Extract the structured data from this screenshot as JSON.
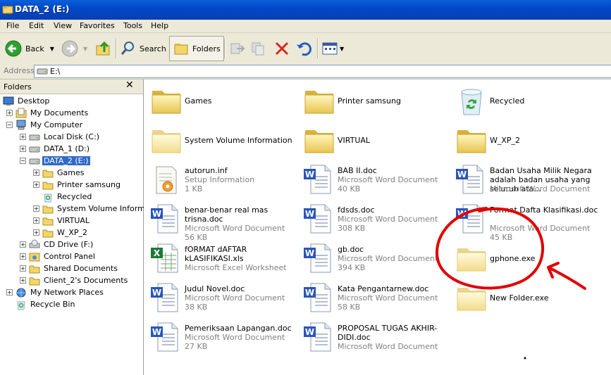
{
  "window": {
    "title": "DATA_2 (E:)"
  },
  "menu": [
    "File",
    "Edit",
    "View",
    "Favorites",
    "Tools",
    "Help"
  ],
  "toolbar": {
    "back_label": "Back",
    "search_label": "Search",
    "folders_label": "Folders"
  },
  "address": {
    "label": "Address",
    "value": "E:\\"
  },
  "folders_pane": {
    "title": "Folders",
    "close": "✕",
    "tree": [
      {
        "label": "Desktop"
      },
      {
        "label": "My Documents"
      },
      {
        "label": "My Computer"
      },
      {
        "label": "Local Disk (C:)"
      },
      {
        "label": "DATA_1 (D:)"
      },
      {
        "label": "DATA_2 (E:)"
      },
      {
        "label": "Games"
      },
      {
        "label": "Printer samsung"
      },
      {
        "label": "Recycled"
      },
      {
        "label": "System Volume Informati"
      },
      {
        "label": "VIRTUAL"
      },
      {
        "label": "W_XP_2"
      },
      {
        "label": "CD Drive (F:)"
      },
      {
        "label": "Control Panel"
      },
      {
        "label": "Shared Documents"
      },
      {
        "label": "Client_2's Documents"
      },
      {
        "label": "My Network Places"
      },
      {
        "label": "Recycle Bin"
      }
    ]
  },
  "files": [
    {
      "name": "Games",
      "icon": "folder-icon"
    },
    {
      "name": "Printer samsung",
      "icon": "folder-icon"
    },
    {
      "name": "Recycled",
      "icon": "recycle-bin-icon"
    },
    {
      "name": "System Volume Information",
      "icon": "folder-icon"
    },
    {
      "name": "VIRTUAL",
      "icon": "folder-icon"
    },
    {
      "name": "W_XP_2",
      "icon": "folder-icon"
    },
    {
      "name": "autorun.inf",
      "type": "Setup Information",
      "size": "1 KB",
      "icon": "setup-file-icon"
    },
    {
      "name": "BAB II.doc",
      "type": "Microsoft Word Document",
      "size": "40 KB",
      "icon": "word-doc-icon"
    },
    {
      "name": "Badan Usaha Milik Negara adalah badan usaha yang seluruh ata...",
      "type": "Microsoft Word Document",
      "size": "",
      "icon": "word-doc-icon"
    },
    {
      "name": "benar-benar real mas trisna.doc",
      "type": "Microsoft Word Document",
      "size": "56 KB",
      "icon": "word-doc-icon"
    },
    {
      "name": "fdsds.doc",
      "type": "Microsoft Word Document",
      "size": "308 KB",
      "icon": "word-doc-icon"
    },
    {
      "name": "Format Dafta Klasifikasi.doc",
      "type": "Microsoft Word Document",
      "size": "45 KB",
      "icon": "word-doc-icon"
    },
    {
      "name": "fORMAT dAFTAR kLASIFIKASI.xls",
      "type": "Microsoft Excel Worksheet",
      "size": "",
      "icon": "excel-doc-icon"
    },
    {
      "name": "gb.doc",
      "type": "Microsoft Word Document",
      "size": "394 KB",
      "icon": "word-doc-icon"
    },
    {
      "name": "gphone.exe",
      "icon": "folder-exe-icon"
    },
    {
      "name": "Judul Novel.doc",
      "type": "Microsoft Word Document",
      "size": "38 KB",
      "icon": "word-doc-icon"
    },
    {
      "name": "Kata Pengantarnew.doc",
      "type": "Microsoft Word Document",
      "size": "58 KB",
      "icon": "word-doc-icon"
    },
    {
      "name": "New Folder.exe",
      "icon": "folder-exe-icon"
    },
    {
      "name": "Pemeriksaan Lapangan.doc",
      "type": "Microsoft Word Document",
      "size": "27 KB",
      "icon": "word-doc-icon"
    },
    {
      "name": "PROPOSAL TUGAS AKHIR-DIDI.doc",
      "type": "Microsoft Word Document",
      "size": "",
      "icon": "word-doc-icon"
    }
  ],
  "colors": {
    "titlebar": "#0048c8",
    "selection": "#316ac5",
    "annotation": "#e00000"
  }
}
